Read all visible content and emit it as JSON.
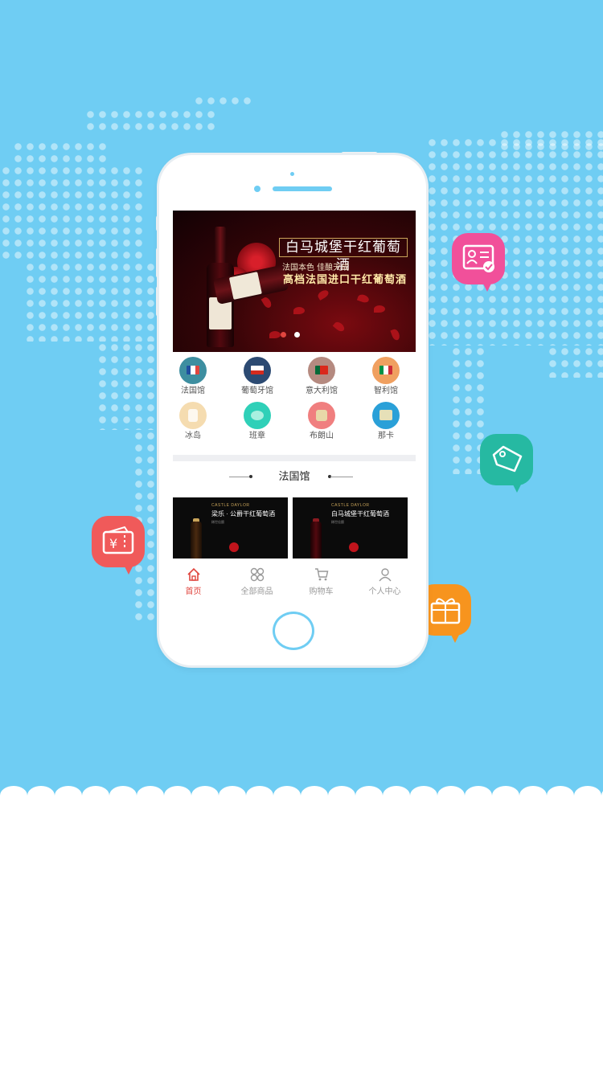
{
  "banner": {
    "title": "白马城堡干红葡萄酒",
    "subtitle": "法国本色   佳酿天成",
    "tagline": "高档法国进口干红葡萄酒",
    "indicators": 2,
    "active_indicator": 0
  },
  "categories": [
    {
      "label": "法国馆",
      "icon": "france-flag-icon"
    },
    {
      "label": "葡萄牙馆",
      "icon": "chile-flag-icon"
    },
    {
      "label": "意大利馆",
      "icon": "portugal-flag-icon"
    },
    {
      "label": "智利馆",
      "icon": "italy-flag-icon"
    },
    {
      "label": "冰岛",
      "icon": "iceland-icon"
    },
    {
      "label": "班章",
      "icon": "teapot-icon"
    },
    {
      "label": "布朗山",
      "icon": "tea-icon"
    },
    {
      "label": "那卡",
      "icon": "tea-box-icon"
    }
  ],
  "section": {
    "title": "法国馆"
  },
  "products": [
    {
      "brand": "CASTLE DAYLOR",
      "title": "梁乐 · 公爵干红葡萄酒",
      "subtitle": "稀世佳酿"
    },
    {
      "brand": "CASTLE DAYLOR",
      "title": "白马城堡干红葡萄酒",
      "subtitle": "稀世佳酿"
    }
  ],
  "tabbar": [
    {
      "label": "首页",
      "icon": "home-icon",
      "active": true
    },
    {
      "label": "全部商品",
      "icon": "grid-icon",
      "active": false
    },
    {
      "label": "购物车",
      "icon": "cart-icon",
      "active": false
    },
    {
      "label": "个人中心",
      "icon": "user-icon",
      "active": false
    }
  ],
  "colors": {
    "background": "#6fcdf3",
    "accent": "#e0463f",
    "bubble_pink": "#f1509a",
    "bubble_teal": "#26b9a2",
    "bubble_red": "#f05a5a",
    "bubble_orange": "#f7941e"
  },
  "decorations": [
    "id-card-icon",
    "tag-icon",
    "coupon-icon",
    "gift-icon"
  ]
}
